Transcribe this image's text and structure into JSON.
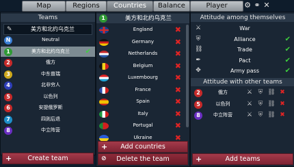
{
  "toolbar": {
    "tabs": [
      {
        "label": "Map"
      },
      {
        "label": "Regions"
      },
      {
        "label": "Countries"
      },
      {
        "label": "Balance"
      },
      {
        "label": "Player"
      }
    ],
    "settings_icon": "gear-icon",
    "link_icon": "link-icon",
    "close_icon": "close-icon"
  },
  "teams": {
    "header": "Teams",
    "name_input_value": "美方和北约乌克兰",
    "items": [
      {
        "badge": "N",
        "name": "Neutral",
        "color": "#3b7fd6",
        "checked": false,
        "selected": false
      },
      {
        "badge": "1",
        "name": "美方和北约乌克兰",
        "color": "#2e9a34",
        "checked": true,
        "selected": true
      },
      {
        "badge": "2",
        "name": "俄方",
        "color": "#c62a2a",
        "checked": false,
        "selected": false
      },
      {
        "badge": "3",
        "name": "中东普瑞",
        "color": "#cfa91d",
        "checked": false,
        "selected": false
      },
      {
        "badge": "4",
        "name": "北非穷人",
        "color": "#2e3eb8",
        "checked": false,
        "selected": false
      },
      {
        "badge": "5",
        "name": "以色列",
        "color": "#c62a2a",
        "checked": false,
        "selected": false
      },
      {
        "badge": "6",
        "name": "安提俄罗斯",
        "color": "#c62a2a",
        "checked": false,
        "selected": false
      },
      {
        "badge": "7",
        "name": "四则后退",
        "color": "#1e8fc9",
        "checked": false,
        "selected": false
      },
      {
        "badge": "8",
        "name": "中立阵营",
        "color": "#6a2ec2",
        "checked": false,
        "selected": false
      }
    ],
    "create_button": "Create team"
  },
  "countries": {
    "header_badge": "1",
    "header": "美方和北约乌克兰",
    "items": [
      {
        "name": "England",
        "flag": "uk"
      },
      {
        "name": "Germany",
        "flag": "de"
      },
      {
        "name": "Netherlands",
        "flag": "nl"
      },
      {
        "name": "Belgium",
        "flag": "be"
      },
      {
        "name": "Luxembourg",
        "flag": "lu"
      },
      {
        "name": "France",
        "flag": "fr"
      },
      {
        "name": "Spain",
        "flag": "es"
      },
      {
        "name": "Italy",
        "flag": "it"
      },
      {
        "name": "Portugal",
        "flag": "pt"
      },
      {
        "name": "Ukraine",
        "flag": "ua"
      }
    ],
    "add_button": "Add countries",
    "delete_button": "Delete the team"
  },
  "attitude_self": {
    "header": "Attitude among themselves",
    "items": [
      {
        "label": "War",
        "icon": "swords-icon",
        "status": "none"
      },
      {
        "label": "Alliance",
        "icon": "shield-icon",
        "status": "yes"
      },
      {
        "label": "Trade",
        "icon": "chain-icon",
        "status": "yes"
      },
      {
        "label": "Pact",
        "icon": "quill-icon",
        "status": "yes"
      },
      {
        "label": "Army pass",
        "icon": "arrows-icon",
        "status": "yes"
      }
    ]
  },
  "attitude_other": {
    "header": "Attitude with other teams",
    "items": [
      {
        "badge": "2",
        "name": "俄方",
        "color": "#c62a2a"
      },
      {
        "badge": "5",
        "name": "以色列",
        "color": "#c62a2a"
      },
      {
        "badge": "8",
        "name": "中立阵营",
        "color": "#6a2ec2"
      }
    ],
    "add_button": "Add teams"
  }
}
